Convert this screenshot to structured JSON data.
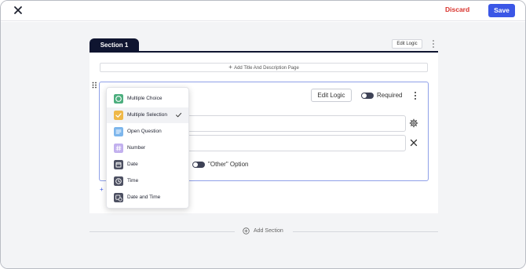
{
  "header": {
    "close_icon": "close-icon",
    "discard_label": "Discard",
    "save_label": "Save",
    "colors": {
      "discard": "#d8322c",
      "save": "#3b57e6"
    }
  },
  "section": {
    "tab_label": "Section 1",
    "edit_logic_label": "Edit Logic",
    "add_title_label": "Add Title And Description Page"
  },
  "question": {
    "edit_logic_label": "Edit Logic",
    "required_label": "Required",
    "other_option_label": "\"Other\" Option"
  },
  "question_types": [
    {
      "label": "Multiple Choice",
      "icon": "radio-circle-icon",
      "color": "#4cae7e",
      "selected": false
    },
    {
      "label": "Multiple Selection",
      "icon": "checkbox-icon",
      "color": "#efb848",
      "selected": true
    },
    {
      "label": "Open Question",
      "icon": "text-lines-icon",
      "color": "#7db6ec",
      "selected": false
    },
    {
      "label": "Number",
      "icon": "hash-icon",
      "color": "#c2b0ee",
      "selected": false
    },
    {
      "label": "Date",
      "icon": "calendar-icon",
      "color": "#4d5062",
      "selected": false
    },
    {
      "label": "Time",
      "icon": "clock-icon",
      "color": "#4d5062",
      "selected": false
    },
    {
      "label": "Date and Time",
      "icon": "calendar-clock-icon",
      "color": "#4d5062",
      "selected": false
    }
  ],
  "footer": {
    "add_section_label": "Add Section"
  }
}
